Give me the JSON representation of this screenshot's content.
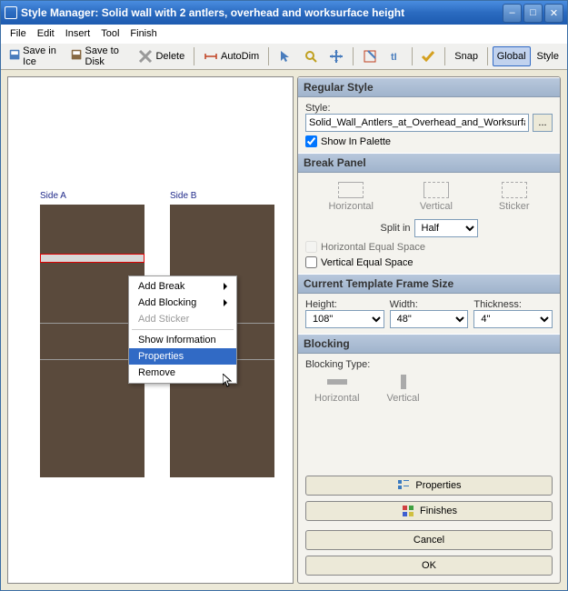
{
  "title": "Style Manager: Solid wall with 2 antlers, overhead and worksurface height",
  "menu": {
    "file": "File",
    "edit": "Edit",
    "insert": "Insert",
    "tool": "Tool",
    "finish": "Finish"
  },
  "toolbar": {
    "saveIce": "Save in Ice",
    "saveDisk": "Save to Disk",
    "delete": "Delete",
    "autoDim": "AutoDim",
    "snap": "Snap",
    "global": "Global",
    "style": "Style"
  },
  "regular": {
    "header": "Regular Style",
    "styleLabel": "Style:",
    "styleValue": "Solid_Wall_Antlers_at_Overhead_and_Worksurface_H",
    "showInPalette": "Show In Palette",
    "showInPaletteChecked": true
  },
  "break": {
    "header": "Break Panel",
    "horizontal": "Horizontal",
    "vertical": "Vertical",
    "sticker": "Sticker",
    "splitLabel": "Split in",
    "splitValue": "Half",
    "hes": "Horizontal Equal Space",
    "ves": "Vertical Equal Space"
  },
  "template": {
    "header": "Current Template Frame Size",
    "heightLabel": "Height:",
    "widthLabel": "Width:",
    "thickLabel": "Thickness:",
    "heightValue": "108\"",
    "widthValue": "48\"",
    "thickValue": "4\""
  },
  "blocking": {
    "header": "Blocking",
    "typeLabel": "Blocking Type:",
    "horizontal": "Horizontal",
    "vertical": "Vertical"
  },
  "buttons": {
    "properties": "Properties",
    "finishes": "Finishes",
    "cancel": "Cancel",
    "ok": "OK"
  },
  "canvas": {
    "sideA": "Side A",
    "sideB": "Side B"
  },
  "context": {
    "addBreak": "Add Break",
    "addBlocking": "Add Blocking",
    "addSticker": "Add Sticker",
    "showInfo": "Show Information",
    "properties": "Properties",
    "remove": "Remove"
  }
}
